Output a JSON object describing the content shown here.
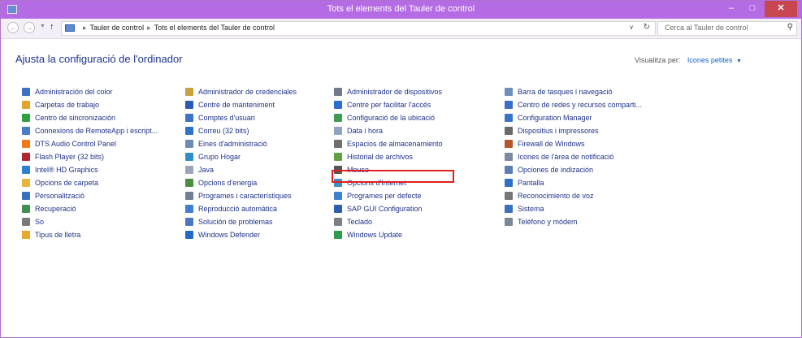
{
  "window": {
    "title": "Tots el elements del Tauler de control",
    "controls": {
      "minimize": "–",
      "maximize": "□",
      "close": "✕"
    }
  },
  "address": {
    "crumbs": [
      "Tauler de control",
      "Tots el elements del Tauler de control"
    ],
    "search_placeholder": "Cerca al Tauler de control"
  },
  "page": {
    "heading": "Ajusta la configuració de l'ordinador",
    "view_by_label": "Visualitza per:",
    "view_by_value": "Icones petites"
  },
  "columns": [
    [
      {
        "label": "Administración del color",
        "icon": "color-management-icon",
        "color": "#3d6fc4"
      },
      {
        "label": "Carpetas de trabajo",
        "icon": "work-folders-icon",
        "color": "#e0a52f"
      },
      {
        "label": "Centro de sincronización",
        "icon": "sync-center-icon",
        "color": "#2fa044"
      },
      {
        "label": "Connexions de RemoteApp i escript...",
        "icon": "remoteapp-icon",
        "color": "#4a7bc8"
      },
      {
        "label": "DTS Audio Control Panel",
        "icon": "dts-audio-icon",
        "color": "#f07a1a"
      },
      {
        "label": "Flash Player (32 bits)",
        "icon": "flash-player-icon",
        "color": "#b0262e"
      },
      {
        "label": "Intel® HD Graphics",
        "icon": "intel-graphics-icon",
        "color": "#2d7fd0"
      },
      {
        "label": "Opcions de carpeta",
        "icon": "folder-options-icon",
        "color": "#e8b53a"
      },
      {
        "label": "Personalització",
        "icon": "personalization-icon",
        "color": "#3a6fc0"
      },
      {
        "label": "Recuperació",
        "icon": "recovery-icon",
        "color": "#3f8f4f"
      },
      {
        "label": "So",
        "icon": "sound-icon",
        "color": "#7a7a7a"
      },
      {
        "label": "Tipus de lletra",
        "icon": "fonts-icon",
        "color": "#e6a92c"
      }
    ],
    [
      {
        "label": "Administrador de credenciales",
        "icon": "credential-manager-icon",
        "color": "#c9a040"
      },
      {
        "label": "Centre de manteniment",
        "icon": "action-center-icon",
        "color": "#2a5bb5"
      },
      {
        "label": "Comptes d'usuari",
        "icon": "user-accounts-icon",
        "color": "#3b74c4"
      },
      {
        "label": "Correu (32 bits)",
        "icon": "mail-icon",
        "color": "#2f72c8"
      },
      {
        "label": "Eines d'administració",
        "icon": "admin-tools-icon",
        "color": "#6b8cb5"
      },
      {
        "label": "Grupo Hogar",
        "icon": "homegroup-icon",
        "color": "#2f8fc8"
      },
      {
        "label": "Java",
        "icon": "java-icon",
        "color": "#9aa6b8"
      },
      {
        "label": "Opcions d'energia",
        "icon": "power-options-icon",
        "color": "#4a8f3c"
      },
      {
        "label": "Programes i característiques",
        "icon": "programs-features-icon",
        "color": "#6f7f95"
      },
      {
        "label": "Reproducció automàtica",
        "icon": "autoplay-icon",
        "color": "#3f7fd0"
      },
      {
        "label": "Solución de problemas",
        "icon": "troubleshooting-icon",
        "color": "#4a78c0"
      },
      {
        "label": "Windows Defender",
        "icon": "windows-defender-icon",
        "color": "#2468c8"
      }
    ],
    [
      {
        "label": "Administrador de dispositivos",
        "icon": "device-manager-icon",
        "color": "#707a88"
      },
      {
        "label": "Centre per facilitar l'accés",
        "icon": "ease-of-access-icon",
        "color": "#2a6ed0"
      },
      {
        "label": "Configuració de la ubicació",
        "icon": "location-settings-icon",
        "color": "#3f9a52"
      },
      {
        "label": "Data i hora",
        "icon": "date-time-icon",
        "color": "#8fa4c0"
      },
      {
        "label": "Espacios de almacenamiento",
        "icon": "storage-spaces-icon",
        "color": "#6e6e6e"
      },
      {
        "label": "Historial de archivos",
        "icon": "file-history-icon",
        "color": "#5fa040"
      },
      {
        "label": "Mouse",
        "icon": "mouse-icon",
        "color": "#555555"
      },
      {
        "label": "Opcions d'Internet",
        "icon": "internet-options-icon",
        "color": "#3f8fc0"
      },
      {
        "label": "Programes per defecte",
        "icon": "default-programs-icon",
        "color": "#3f7fd0"
      },
      {
        "label": "SAP GUI Configuration",
        "icon": "sap-gui-icon",
        "color": "#2a5fae"
      },
      {
        "label": "Teclado",
        "icon": "keyboard-icon",
        "color": "#7b7f86"
      },
      {
        "label": "Windows Update",
        "icon": "windows-update-icon",
        "color": "#2f9a4a"
      }
    ],
    [
      {
        "label": "Barra de tasques i navegació",
        "icon": "taskbar-icon",
        "color": "#6f8fb8"
      },
      {
        "label": "Centro de redes y recursos comparti...",
        "icon": "network-center-icon",
        "color": "#3a6ec8"
      },
      {
        "label": "Configuration Manager",
        "icon": "configuration-manager-icon",
        "color": "#3a74c8"
      },
      {
        "label": "Dispositius i impressores",
        "icon": "devices-printers-icon",
        "color": "#6a6a6a"
      },
      {
        "label": "Firewall de Windows",
        "icon": "firewall-icon",
        "color": "#b8562a"
      },
      {
        "label": "Icones de l'àrea de notificació",
        "icon": "notification-area-icon",
        "color": "#7a8aa0"
      },
      {
        "label": "Opciones de indización",
        "icon": "indexing-options-icon",
        "color": "#5a7fb0"
      },
      {
        "label": "Pantalla",
        "icon": "display-icon",
        "color": "#2f6fc8"
      },
      {
        "label": "Reconocimiento de voz",
        "icon": "speech-recognition-icon",
        "color": "#777777"
      },
      {
        "label": "Sistema",
        "icon": "system-icon",
        "color": "#3b70c0"
      },
      {
        "label": "Teléfono y módem",
        "icon": "phone-modem-icon",
        "color": "#7a8695"
      }
    ]
  ]
}
